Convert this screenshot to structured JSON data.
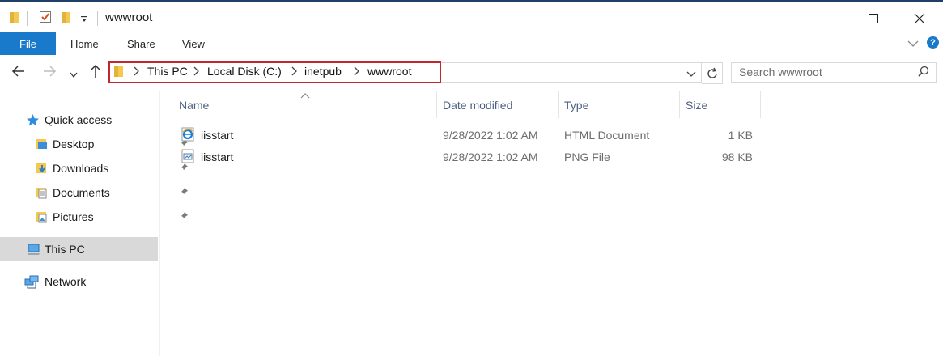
{
  "window": {
    "title": "wwwroot",
    "controls": [
      "minimize",
      "maximize",
      "close"
    ]
  },
  "ribbon": {
    "tabs": [
      "File",
      "Home",
      "Share",
      "View"
    ],
    "help_glyph": "?"
  },
  "address": {
    "breadcrumbs": [
      "This PC",
      "Local Disk (C:)",
      "inetpub",
      "wwwroot"
    ]
  },
  "search": {
    "placeholder": "Search wwwroot"
  },
  "nav": {
    "quick_access": "Quick access",
    "pinned": [
      {
        "label": "Desktop",
        "icon": "desktop-folder-icon"
      },
      {
        "label": "Downloads",
        "icon": "downloads-folder-icon"
      },
      {
        "label": "Documents",
        "icon": "documents-folder-icon"
      },
      {
        "label": "Pictures",
        "icon": "pictures-folder-icon"
      }
    ],
    "this_pc": "This PC",
    "network": "Network"
  },
  "columns": {
    "name": "Name",
    "date": "Date modified",
    "type": "Type",
    "size": "Size"
  },
  "files": [
    {
      "name": "iisstart",
      "date": "9/28/2022 1:02 AM",
      "type": "HTML Document",
      "size": "1 KB",
      "icon": "html-document-icon"
    },
    {
      "name": "iisstart",
      "date": "9/28/2022 1:02 AM",
      "type": "PNG File",
      "size": "98 KB",
      "icon": "png-file-icon"
    }
  ],
  "colors": {
    "accent": "#1979ca",
    "highlight_border": "#c0282d",
    "selected_bg": "#d9d9d9",
    "header_text": "#4d6082"
  }
}
